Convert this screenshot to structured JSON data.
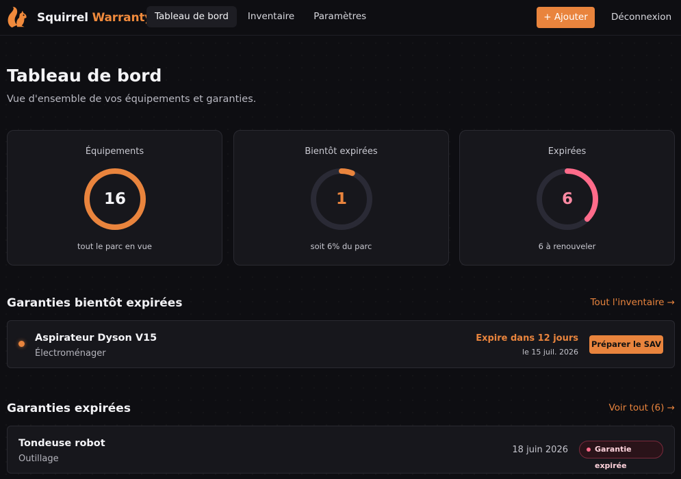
{
  "brand": {
    "name_part1": "Squirrel",
    "name_part2": "Warranty",
    "logo": "squirrel-icon",
    "accent": "#f08a3c"
  },
  "nav": {
    "items": [
      {
        "label": "Tableau de bord",
        "active": true
      },
      {
        "label": "Inventaire",
        "active": false
      },
      {
        "label": "Paramètres",
        "active": false
      }
    ]
  },
  "header_actions": {
    "add_label": "+ Ajouter",
    "logout_label": "Déconnexion"
  },
  "page": {
    "title": "Tableau de bord",
    "subtitle": "Vue d'ensemble de vos équipements et garanties."
  },
  "stats": [
    {
      "label": "Équipements",
      "value": "16",
      "footer": "tout le parc en vue",
      "progress": 1.0,
      "color": "#e9843d",
      "value_color": "#f3f3f6"
    },
    {
      "label": "Bientôt expirées",
      "value": "1",
      "footer": "soit 6% du parc",
      "progress": 0.0625,
      "color": "#e9843d",
      "value_color": "#e9843d"
    },
    {
      "label": "Expirées",
      "value": "6",
      "footer": "6 à renouveler",
      "progress": 0.375,
      "color": "#ff6b8a",
      "value_color": "#ff8aa3"
    }
  ],
  "soon": {
    "title": "Garanties bientôt expirées",
    "link": "Tout l'inventaire →",
    "items": [
      {
        "name": "Aspirateur Dyson V15",
        "category": "Électroménager",
        "expire_text": "Expire dans 12 jours",
        "date": "le 15 juil. 2026",
        "action": "Préparer le SAV"
      }
    ]
  },
  "expired": {
    "title": "Garanties expirées",
    "link": "Voir tout (6) →",
    "items": [
      {
        "name": "Tondeuse robot",
        "category": "Outillage",
        "date": "18 juin 2026",
        "badge": "Garantie expirée"
      }
    ]
  },
  "colors": {
    "accent": "#e9843d",
    "danger": "#ff6b8a",
    "track": "#2a2a35"
  }
}
